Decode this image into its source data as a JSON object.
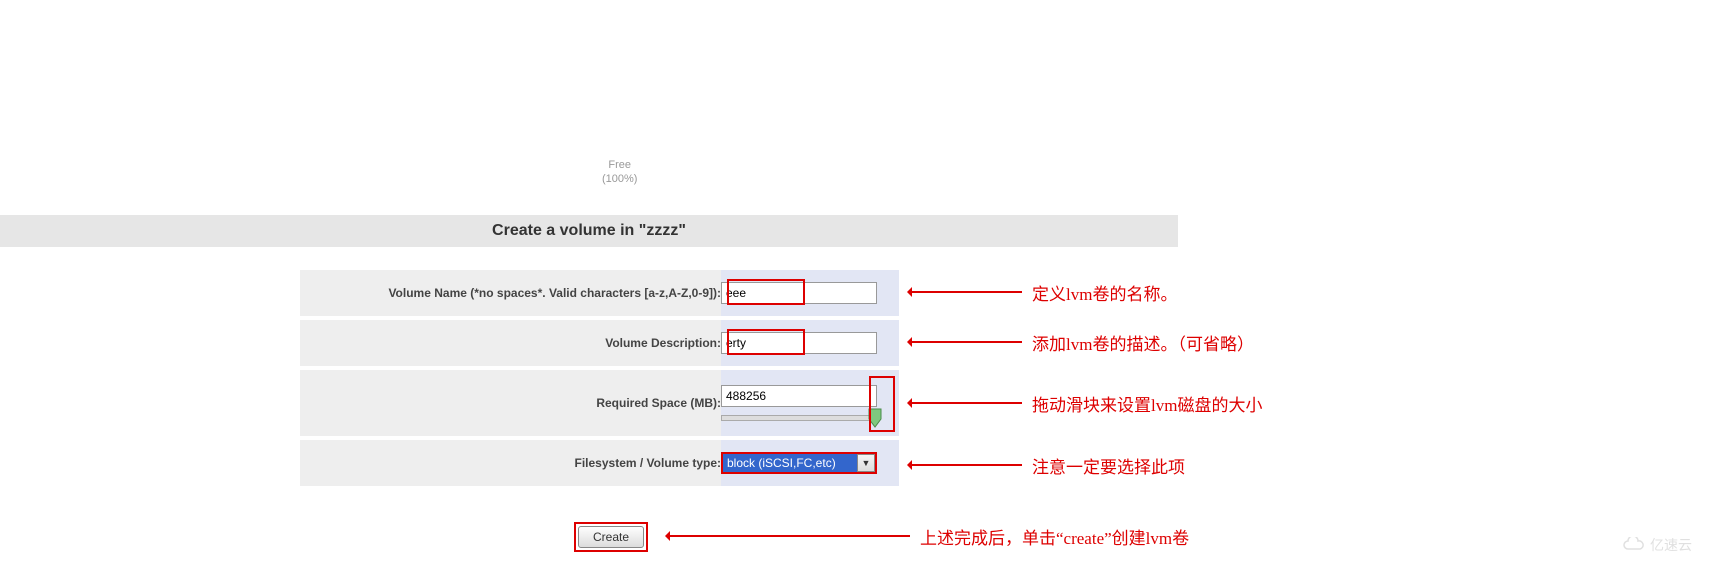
{
  "free_label": {
    "line1": "Free",
    "line2": "(100%)"
  },
  "heading": "Create a volume in \"zzzz\"",
  "form": {
    "volume_name": {
      "label": "Volume Name (*no spaces*. Valid characters [a-z,A-Z,0-9]):",
      "value": "eee"
    },
    "volume_description": {
      "label": "Volume Description:",
      "value": "erty"
    },
    "required_space": {
      "label": "Required Space (MB):",
      "value": "488256"
    },
    "fs_type": {
      "label": "Filesystem / Volume type:",
      "selected": "block (iSCSI,FC,etc)"
    }
  },
  "create_button": "Create",
  "annotations": {
    "a1": "定义lvm卷的名称。",
    "a2": "添加lvm卷的描述。（可省略）",
    "a3": "拖动滑块来设置lvm磁盘的大小",
    "a4": "注意一定要选择此项",
    "a5": "上述完成后，单击“create”创建lvm卷"
  },
  "watermark": "亿速云"
}
